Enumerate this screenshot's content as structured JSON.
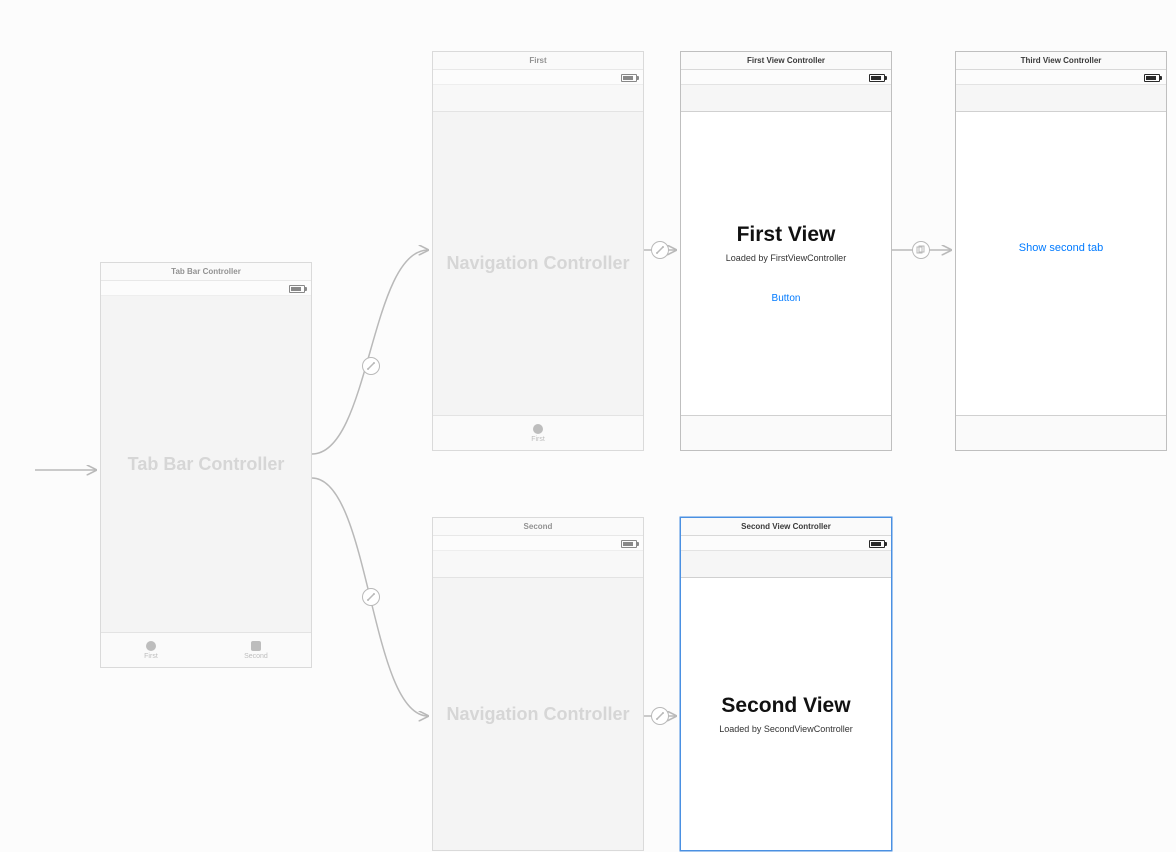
{
  "tabbar_controller": {
    "header": "Tab Bar Controller",
    "body_title": "Tab Bar Controller",
    "tab_first": "First",
    "tab_second": "Second"
  },
  "nav_first": {
    "header": "First",
    "body_title": "Navigation Controller",
    "tab_label": "First"
  },
  "first_view": {
    "header": "First View Controller",
    "body_title": "First View",
    "body_sub": "Loaded by FirstViewController",
    "button_label": "Button"
  },
  "third_view": {
    "header": "Third View Controller",
    "button_label": "Show second tab"
  },
  "nav_second": {
    "header": "Second",
    "body_title": "Navigation Controller"
  },
  "second_view": {
    "header": "Second View Controller",
    "body_title": "Second View",
    "body_sub": "Loaded by SecondViewController"
  }
}
